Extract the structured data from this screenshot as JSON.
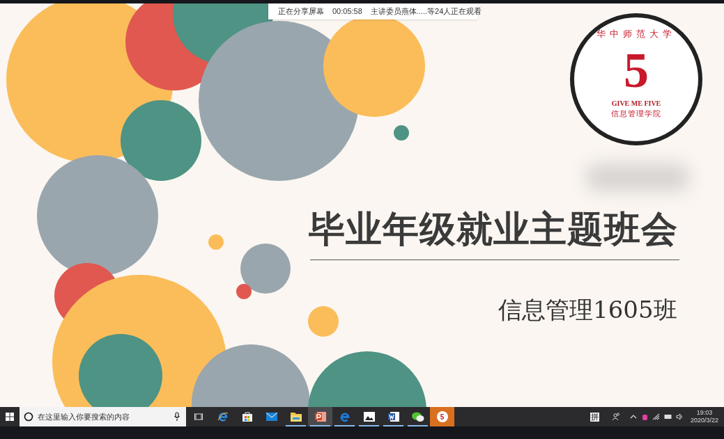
{
  "sharing_bar": {
    "status": "正在分享屏幕",
    "elapsed": "00:05:58",
    "viewers": "主讲委员燕体.....等24人正在观看"
  },
  "slide": {
    "logo": {
      "university": "华中师范大学",
      "numeral": "5",
      "tagline": "GIVE ME FIVE",
      "college": "信息管理学院"
    },
    "title": "毕业年级就业主题班会",
    "subtitle": "信息管理1605班"
  },
  "taskbar": {
    "search": {
      "placeholder": "在这里输入你要搜索的内容"
    },
    "apps": [
      {
        "kind": "task-view",
        "running": false,
        "selected": false
      },
      {
        "kind": "ie",
        "running": false,
        "selected": false
      },
      {
        "kind": "store",
        "running": false,
        "selected": false
      },
      {
        "kind": "mail",
        "running": false,
        "selected": false
      },
      {
        "kind": "folder",
        "running": true,
        "selected": false
      },
      {
        "kind": "powerpoint",
        "running": true,
        "selected": true
      },
      {
        "kind": "edge",
        "running": true,
        "selected": false
      },
      {
        "kind": "photos",
        "running": true,
        "selected": false
      },
      {
        "kind": "word",
        "running": true,
        "selected": false
      },
      {
        "kind": "wechat",
        "running": true,
        "selected": false
      },
      {
        "kind": "badge",
        "label": "5",
        "running": false,
        "selected": false
      }
    ],
    "ime": "拼",
    "time": "19:03",
    "date": "2020/3/22"
  }
}
